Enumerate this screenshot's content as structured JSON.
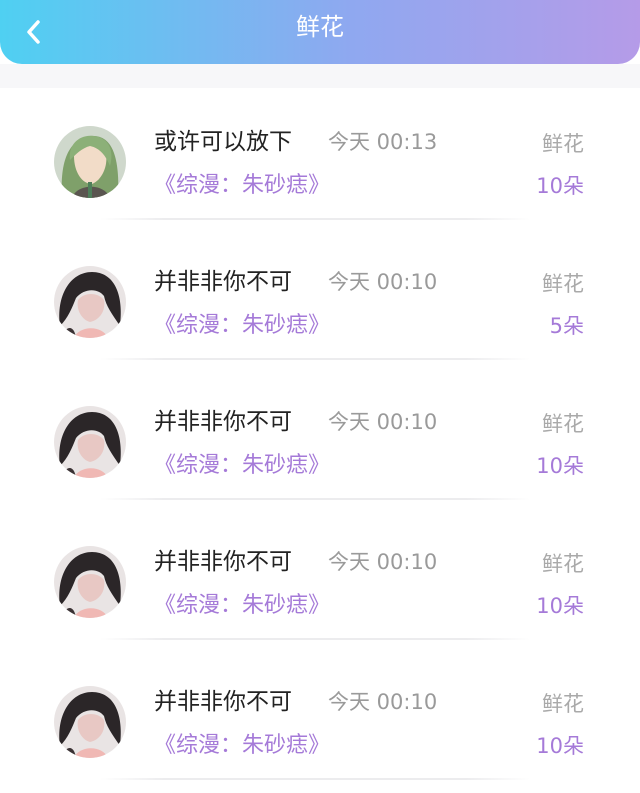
{
  "header": {
    "title": "鲜花",
    "back_icon": "chevron-left-icon"
  },
  "colors": {
    "header_start": "#4fd0f2",
    "header_end": "#b59be8",
    "accent": "#a57ad8"
  },
  "records": [
    {
      "avatar": "green-hair-character-avatar",
      "name": "或许可以放下",
      "time": "今天 00:13",
      "work": "《综漫：朱砂痣》",
      "gift": "鲜花",
      "count": "10朵"
    },
    {
      "avatar": "dark-hair-character-avatar",
      "name": "并非非你不可",
      "time": "今天 00:10",
      "work": "《综漫：朱砂痣》",
      "gift": "鲜花",
      "count": "5朵"
    },
    {
      "avatar": "dark-hair-character-avatar",
      "name": "并非非你不可",
      "time": "今天 00:10",
      "work": "《综漫：朱砂痣》",
      "gift": "鲜花",
      "count": "10朵"
    },
    {
      "avatar": "dark-hair-character-avatar",
      "name": "并非非你不可",
      "time": "今天 00:10",
      "work": "《综漫：朱砂痣》",
      "gift": "鲜花",
      "count": "10朵"
    },
    {
      "avatar": "dark-hair-character-avatar",
      "name": "并非非你不可",
      "time": "今天 00:10",
      "work": "《综漫：朱砂痣》",
      "gift": "鲜花",
      "count": "10朵"
    }
  ]
}
